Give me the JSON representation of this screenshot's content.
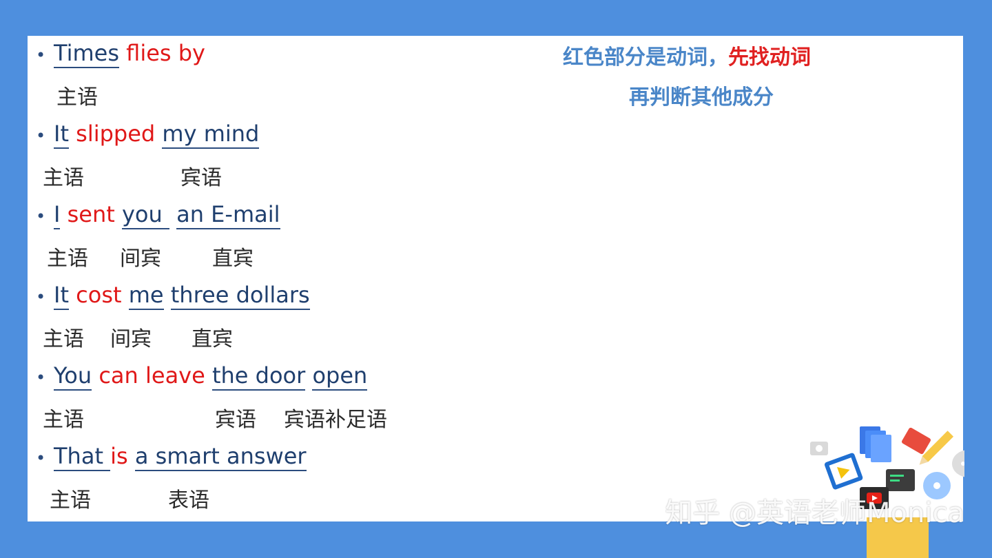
{
  "sentences": [
    {
      "parts": [
        {
          "text": "Times",
          "u": true,
          "red": false
        },
        {
          "text": " ",
          "u": false,
          "red": false
        },
        {
          "text": "flies by",
          "u": false,
          "red": true
        }
      ],
      "labels": [
        "主语"
      ]
    },
    {
      "parts": [
        {
          "text": "It",
          "u": true,
          "red": false
        },
        {
          "text": " ",
          "u": false,
          "red": false
        },
        {
          "text": "slipped",
          "u": false,
          "red": true
        },
        {
          "text": " ",
          "u": false,
          "red": false
        },
        {
          "text": "my mind",
          "u": true,
          "red": false
        }
      ],
      "labels": [
        "主语",
        "宾语"
      ]
    },
    {
      "parts": [
        {
          "text": "I",
          "u": true,
          "red": false
        },
        {
          "text": " ",
          "u": false,
          "red": false
        },
        {
          "text": "sent",
          "u": false,
          "red": true
        },
        {
          "text": " ",
          "u": false,
          "red": false
        },
        {
          "text": "you ",
          "u": true,
          "red": false
        },
        {
          "text": " ",
          "u": false,
          "red": false
        },
        {
          "text": "an E-mail",
          "u": true,
          "red": false
        }
      ],
      "labels": [
        "主语",
        "间宾",
        "直宾"
      ]
    },
    {
      "parts": [
        {
          "text": "It",
          "u": true,
          "red": false
        },
        {
          "text": " ",
          "u": false,
          "red": false
        },
        {
          "text": "cost",
          "u": false,
          "red": true
        },
        {
          "text": " ",
          "u": false,
          "red": false
        },
        {
          "text": "me",
          "u": true,
          "red": false
        },
        {
          "text": " ",
          "u": false,
          "red": false
        },
        {
          "text": "three dollars",
          "u": true,
          "red": false
        }
      ],
      "labels": [
        "主语",
        "间宾",
        "直宾"
      ]
    },
    {
      "parts": [
        {
          "text": "You",
          "u": true,
          "red": false
        },
        {
          "text": " ",
          "u": false,
          "red": false
        },
        {
          "text": "can leave",
          "u": false,
          "red": true
        },
        {
          "text": " ",
          "u": false,
          "red": false
        },
        {
          "text": "the door",
          "u": true,
          "red": false
        },
        {
          "text": " ",
          "u": false,
          "red": false
        },
        {
          "text": "open",
          "u": true,
          "red": false
        }
      ],
      "labels": [
        "主语",
        "宾语",
        "宾语补足语"
      ]
    },
    {
      "parts": [
        {
          "text": "That ",
          "u": true,
          "red": false
        },
        {
          "text": "is",
          "u": false,
          "red": true
        },
        {
          "text": " ",
          "u": false,
          "red": false
        },
        {
          "text": "a smart answer",
          "u": true,
          "red": false
        }
      ],
      "labels": [
        "主语",
        "表语"
      ]
    }
  ],
  "note": {
    "line1_blue": "红色部分是动词，",
    "line1_red": "先找动词",
    "line2": "再判断其他成分"
  },
  "watermark": "知乎 @英语老师Monica",
  "colors": {
    "background": "#4e8fde",
    "verb": "#e01818",
    "text": "#1f3f6e",
    "note": "#4a86c8"
  }
}
